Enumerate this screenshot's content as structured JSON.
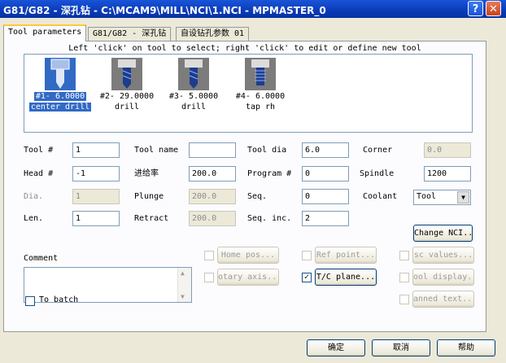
{
  "window": {
    "title": "G81/G82 - 深孔钻 - C:\\MCAM9\\MILL\\NCI\\1.NCI - MPMASTER_0",
    "help_glyph": "?",
    "close_glyph": "✕"
  },
  "tabs": [
    {
      "label": "Tool parameters"
    },
    {
      "label": "G81/G82 - 深孔钻"
    },
    {
      "label": "自设钻孔参数 01"
    }
  ],
  "hint": "Left 'click' on tool to select; right 'click' to edit or define new tool",
  "tools": [
    {
      "line1": "#1- 6.0000",
      "line2": "center drill",
      "icon": "center-drill-icon",
      "selected": true
    },
    {
      "line1": "#2- 29.0000",
      "line2": "drill",
      "icon": "drill-icon",
      "selected": false
    },
    {
      "line1": "#3- 5.0000",
      "line2": "drill",
      "icon": "drill-icon",
      "selected": false
    },
    {
      "line1": "#4- 6.0000",
      "line2": "tap rh",
      "icon": "tap-icon",
      "selected": false
    }
  ],
  "fields": {
    "tool_num": {
      "label": "Tool #",
      "value": "1"
    },
    "head_num": {
      "label": "Head #",
      "value": "-1"
    },
    "dia": {
      "label": "Dia.",
      "value": "1"
    },
    "len": {
      "label": "Len.",
      "value": "1"
    },
    "tool_name": {
      "label": "Tool name",
      "value": ""
    },
    "feed": {
      "label": "进给率",
      "value": "200.0"
    },
    "plunge": {
      "label": "Plunge",
      "value": "200.0"
    },
    "retract": {
      "label": "Retract",
      "value": "200.0"
    },
    "tool_dia": {
      "label": "Tool dia",
      "value": "6.0"
    },
    "program_num": {
      "label": "Program #",
      "value": "0"
    },
    "seq": {
      "label": "Seq.",
      "value": "0"
    },
    "seq_inc": {
      "label": "Seq. inc.",
      "value": "2"
    },
    "corner": {
      "label": "Corner",
      "value": "0.0"
    },
    "spindle": {
      "label": "Spindle",
      "value": "1200"
    },
    "coolant": {
      "label": "Coolant",
      "value": "Tool"
    }
  },
  "comment_label": "Comment",
  "buttons": {
    "change_nci": "Change NCI...",
    "home_pos": "Home pos...",
    "ref_point": "Ref point...",
    "misc_values": "sc values...",
    "rotary_axis": "otary axis...",
    "tc_plane": "T/C plane...",
    "tool_display": "ool display...",
    "canned_text": "anned text...",
    "ok": "确定",
    "cancel": "取消",
    "help": "帮助"
  },
  "to_batch_label": "To batch",
  "checks": {
    "tc_plane": "✓"
  },
  "colors": {
    "title_bar": "#0a3bb8",
    "selection": "#316ac5",
    "dialog_bg": "#ece9d8"
  }
}
